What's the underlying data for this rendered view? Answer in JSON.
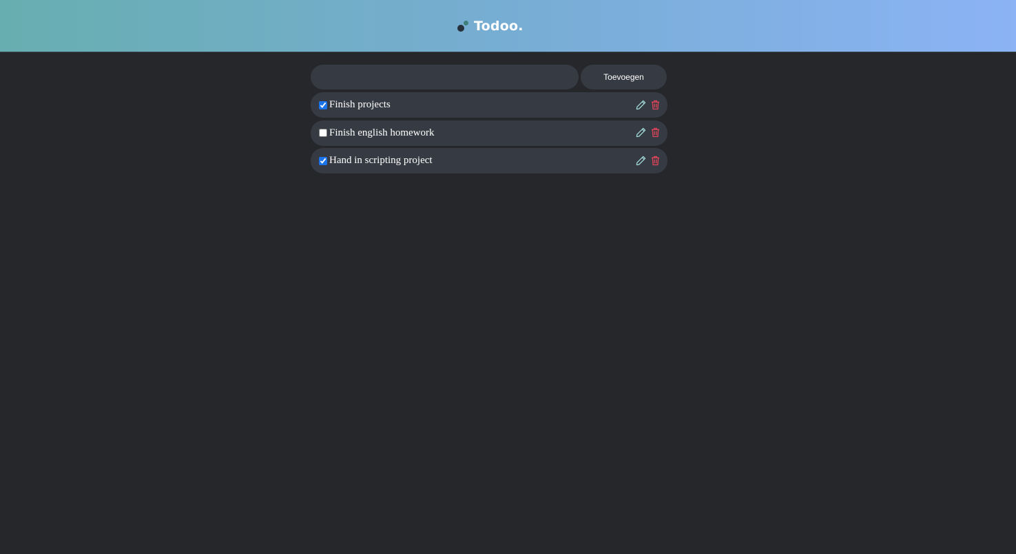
{
  "header": {
    "brand": "Todoo.",
    "logo_icon": "two-dots-logo",
    "gradient": [
      "#67aeb0",
      "#8bb3f5"
    ]
  },
  "add_form": {
    "input_value": "",
    "input_placeholder": "",
    "button_label": "Toevoegen"
  },
  "todos": [
    {
      "text": "Finish projects",
      "done": true
    },
    {
      "text": "Finish english homework",
      "done": false
    },
    {
      "text": "Hand in scripting project",
      "done": true
    }
  ],
  "icons": {
    "edit": "pencil-icon",
    "delete": "trash-icon"
  },
  "colors": {
    "background": "#26272b",
    "panel": "#363a43",
    "edit_icon": "#9fd8d6",
    "delete_icon": "#e0455a"
  }
}
